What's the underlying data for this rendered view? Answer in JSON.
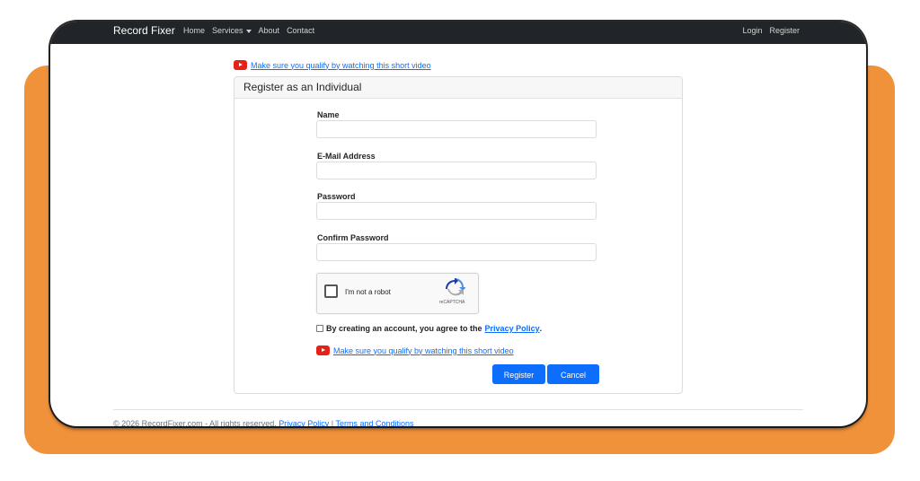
{
  "navbar": {
    "brand": "Record Fixer",
    "links": [
      "Home",
      "Services",
      "About",
      "Contact"
    ],
    "right_links": [
      "Login",
      "Register"
    ]
  },
  "video_link": {
    "text": "Make sure you qualify by watching this short video",
    "icon": "youtube-icon"
  },
  "form": {
    "title": "Register as an Individual",
    "fields": [
      {
        "label": "Name",
        "value": "",
        "placeholder": ""
      },
      {
        "label": "E-Mail Address",
        "value": "",
        "placeholder": ""
      },
      {
        "label": "Password",
        "value": "",
        "placeholder": ""
      },
      {
        "label": "Confirm Password",
        "value": "",
        "placeholder": ""
      }
    ],
    "captcha": {
      "label": "I'm not a robot",
      "brand": "reCAPTCHA"
    },
    "agree": {
      "prefix": "By creating an account, you agree to the",
      "link": "Privacy Policy",
      "suffix": "."
    },
    "register_label": "Register",
    "cancel_label": "Cancel"
  },
  "footer": {
    "text": "© 2026 RecordFixer.com - All rights reserved.",
    "privacy_link": "Privacy Policy",
    "separator": "|",
    "terms_link": "Terms and Conditions"
  },
  "colors": {
    "accent": "#0d6efd",
    "navbar": "#212529",
    "background_orange": "#f0923a",
    "youtube": "#e62117"
  }
}
